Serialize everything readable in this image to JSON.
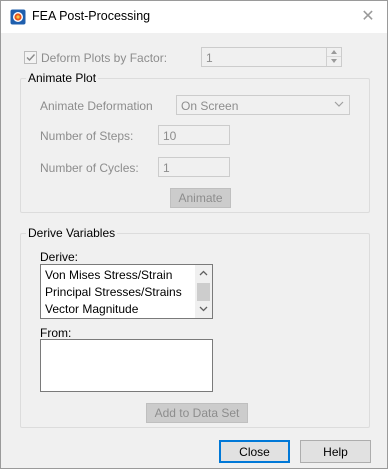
{
  "window": {
    "title": "FEA Post-Processing",
    "close_glyph": "✕"
  },
  "deform": {
    "checked": true,
    "enabled": false,
    "label": "Deform Plots by Factor:",
    "factor_value": "1"
  },
  "animate_plot": {
    "group_label": "Animate Plot",
    "deformation_label": "Animate Deformation",
    "deformation_value": "On Screen",
    "steps_label": "Number of Steps:",
    "steps_value": "10",
    "cycles_label": "Number of Cycles:",
    "cycles_value": "1",
    "animate_button": "Animate"
  },
  "derive_variables": {
    "group_label": "Derive Variables",
    "derive_label": "Derive:",
    "derive_items": [
      "Von Mises Stress/Strain",
      "Principal Stresses/Strains",
      "Vector Magnitude"
    ],
    "from_label": "From:",
    "add_button": "Add to Data Set"
  },
  "footer": {
    "close_button": "Close",
    "help_button": "Help"
  },
  "colors": {
    "dialog_bg": "#f0f0f0",
    "disabled_text": "#8d8d8d",
    "default_button_border": "#0078d7"
  }
}
